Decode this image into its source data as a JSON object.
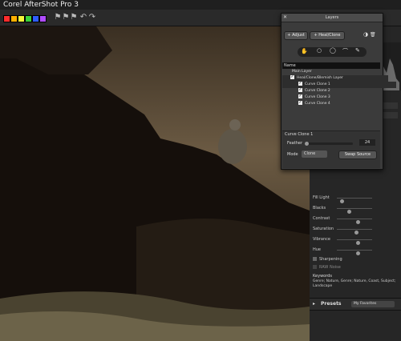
{
  "app": {
    "title": "Corel AfterShot Pro 3"
  },
  "toolbar": {
    "swatches": [
      "#ff2d2d",
      "#ffb000",
      "#f5f53b",
      "#3bd13b",
      "#2f5cff",
      "#b04cff"
    ],
    "icons": [
      "flag-icon",
      "flag-icon",
      "flag-icon",
      "undo-icon",
      "redo-icon"
    ]
  },
  "layers": {
    "tab_label": "Heal/Clone/Blemish Layer",
    "title": "Layers",
    "adjust_label": "Adjust",
    "healclone_label": "Heal/Clone",
    "name_header": "Name",
    "rows": [
      {
        "label": "Main Layer",
        "indent": 0,
        "selected": false,
        "checked": false
      },
      {
        "label": "Heal/Clone/Blemish Layer",
        "indent": 1,
        "selected": true,
        "checked": true
      },
      {
        "label": "Curve Clone 1",
        "indent": 2,
        "selected": true,
        "checked": true
      },
      {
        "label": "Curve Clone 2",
        "indent": 2,
        "selected": false,
        "checked": true
      },
      {
        "label": "Curve Clone 3",
        "indent": 2,
        "selected": false,
        "checked": true
      },
      {
        "label": "Curve Clone 4",
        "indent": 2,
        "selected": false,
        "checked": true
      }
    ],
    "props": {
      "section_title": "Curve Clone 1",
      "feather_label": "Feather",
      "feather_value": "24",
      "mode_label": "Mode",
      "mode_value": "Clone",
      "swap_label": "Swap Source"
    }
  },
  "adjust": {
    "sliders": [
      {
        "label": "Fill Light",
        "level": 0.1
      },
      {
        "label": "Blacks",
        "level": 0.3
      },
      {
        "label": "Contrast",
        "level": 0.55
      },
      {
        "label": "Saturation",
        "level": 0.5
      },
      {
        "label": "Vibrance",
        "level": 0.55
      },
      {
        "label": "Hue",
        "level": 0.55
      }
    ],
    "sharpening_label": "Sharpening",
    "noise_label": "RAW Noise"
  },
  "keywords": {
    "title": "Keywords",
    "text": "Genre; Nature, Genre; Nature, Coast, Subject; Landscape"
  },
  "presets": {
    "title": "Presets",
    "dropdown": "My Favorites"
  }
}
